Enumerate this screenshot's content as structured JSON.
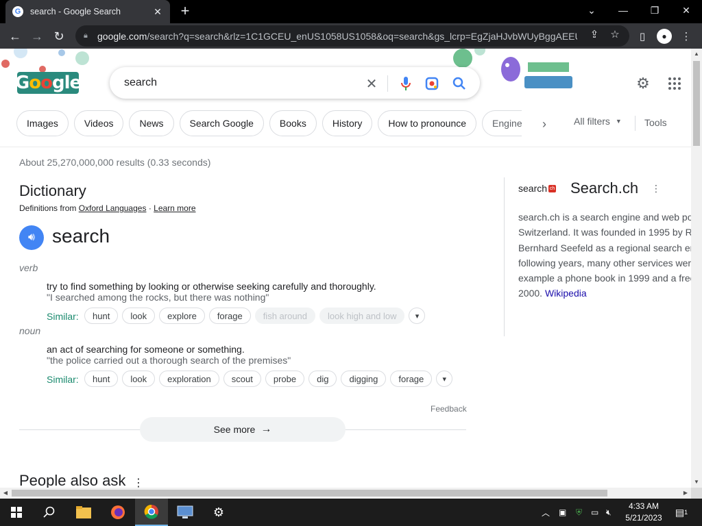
{
  "browser": {
    "tab_title": "search - Google Search",
    "tab_close": "✕",
    "new_tab": "+",
    "url_host": "google.com",
    "url_rest": "/search?q=search&rlz=1C1GCEU_enUS1058US1058&oq=search&gs_lcrp=EgZjaHJvbWUyBggAEEUY..."
  },
  "google": {
    "logo_text_g": "G",
    "logo_text_o1": "o",
    "logo_text_o2": "o",
    "logo_text_rest": "gle",
    "query": "search"
  },
  "chips": [
    "Images",
    "Videos",
    "News",
    "Search Google",
    "Books",
    "History",
    "How to pronounce",
    "Engine"
  ],
  "filters": {
    "all_filters": "All filters",
    "tools": "Tools"
  },
  "stats": "About 25,270,000,000 results (0.33 seconds)",
  "dictionary": {
    "title": "Dictionary",
    "defs_from": "Definitions from",
    "source": "Oxford Languages",
    "separator": "·",
    "learn_more": "Learn more",
    "word": "search",
    "similar_label": "Similar:",
    "senses": [
      {
        "pos": "verb",
        "definition": "try to find something by looking or otherwise seeking carefully and thoroughly.",
        "example": "\"I searched among the rocks, but there was nothing\"",
        "synonyms": [
          "hunt",
          "look",
          "explore",
          "forage"
        ],
        "faded_synonyms": [
          "fish around",
          "look high and low"
        ]
      },
      {
        "pos": "noun",
        "definition": "an act of searching for someone or something.",
        "example": "\"the police carried out a thorough search of the premises\"",
        "synonyms": [
          "hunt",
          "look",
          "exploration",
          "scout",
          "probe",
          "dig",
          "digging",
          "forage"
        ],
        "faded_synonyms": []
      }
    ],
    "feedback": "Feedback",
    "see_more": "See more"
  },
  "people_also_ask": "People also ask",
  "knowledge_panel": {
    "logo_text": "search",
    "logo_badge": "ch",
    "title": "Search.ch",
    "lines": [
      "search.ch is a search engine and web po",
      "Switzerland. It was founded in 1995 by R",
      "Bernhard Seefeld as a regional search en",
      "following years, many other services wer",
      "example a phone book in 1999 and a free"
    ],
    "last_line_prefix": "2000.",
    "wiki_link": "Wikipedia"
  },
  "taskbar": {
    "time": "4:33 AM",
    "date": "5/21/2023",
    "notification_count": "1"
  }
}
